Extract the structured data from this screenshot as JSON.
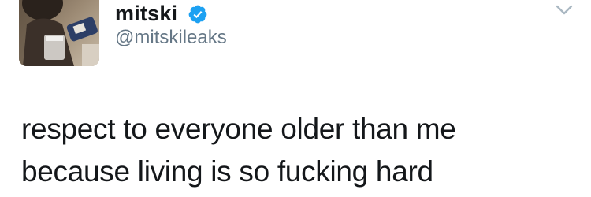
{
  "tweet": {
    "author": {
      "display_name": "mitski",
      "handle": "@mitskileaks",
      "verified": true,
      "avatar_icon": "profile-photo"
    },
    "text_lines": [
      "respect to everyone older than me",
      "because living is so fucking hard"
    ],
    "menu_icon": "chevron-down-icon"
  },
  "colors": {
    "verified_badge": "#1da1f2",
    "handle_text": "#657786",
    "body_text": "#14171a",
    "caret": "#aab8c2"
  }
}
